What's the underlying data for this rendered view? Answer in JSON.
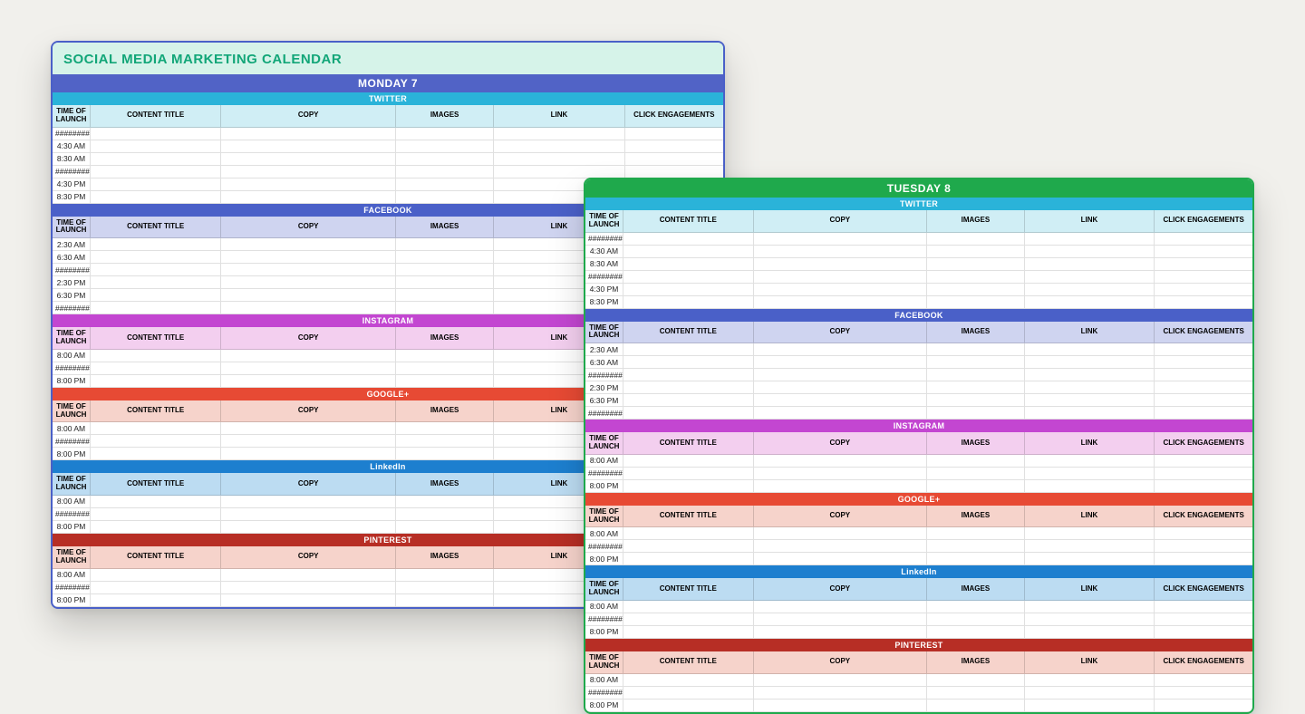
{
  "title": "SOCIAL MEDIA MARKETING CALENDAR",
  "columns": {
    "time": "TIME OF LAUNCH",
    "content": "CONTENT TITLE",
    "copy": "COPY",
    "images": "IMAGES",
    "link": "LINK",
    "clicks": "CLICK ENGAGEMENTS"
  },
  "monday": {
    "day_label": "MONDAY   7",
    "platforms": [
      {
        "name": "TWITTER",
        "bar_class": "pf-twitter",
        "hd_class": "hd-twitter",
        "times": [
          "########",
          "4:30 AM",
          "8:30 AM",
          "########",
          "4:30 PM",
          "8:30 PM"
        ]
      },
      {
        "name": "FACEBOOK",
        "bar_class": "pf-facebook",
        "hd_class": "hd-facebook",
        "times": [
          "2:30 AM",
          "6:30 AM",
          "########",
          "2:30 PM",
          "6:30 PM",
          "########"
        ]
      },
      {
        "name": "INSTAGRAM",
        "bar_class": "pf-instagram",
        "hd_class": "hd-instagram",
        "times": [
          "8:00 AM",
          "########",
          "8:00 PM"
        ]
      },
      {
        "name": "GOOGLE+",
        "bar_class": "pf-google",
        "hd_class": "hd-google",
        "times": [
          "8:00 AM",
          "########",
          "8:00 PM"
        ]
      },
      {
        "name": "LinkedIn",
        "bar_class": "pf-linkedin",
        "hd_class": "hd-linkedin",
        "times": [
          "8:00 AM",
          "########",
          "8:00 PM"
        ]
      },
      {
        "name": "PINTEREST",
        "bar_class": "pf-pinterest",
        "hd_class": "hd-pinterest",
        "times": [
          "8:00 AM",
          "########",
          "8:00 PM"
        ]
      }
    ]
  },
  "tuesday": {
    "day_label": "TUESDAY   8",
    "platforms": [
      {
        "name": "TWITTER",
        "bar_class": "pf-twitter",
        "hd_class": "hd-twitter",
        "times": [
          "########",
          "4:30 AM",
          "8:30 AM",
          "########",
          "4:30 PM",
          "8:30 PM"
        ]
      },
      {
        "name": "FACEBOOK",
        "bar_class": "pf-facebook",
        "hd_class": "hd-facebook",
        "times": [
          "2:30 AM",
          "6:30 AM",
          "########",
          "2:30 PM",
          "6:30 PM",
          "########"
        ]
      },
      {
        "name": "INSTAGRAM",
        "bar_class": "pf-instagram",
        "hd_class": "hd-instagram",
        "times": [
          "8:00 AM",
          "########",
          "8:00 PM"
        ]
      },
      {
        "name": "GOOGLE+",
        "bar_class": "pf-google",
        "hd_class": "hd-google",
        "times": [
          "8:00 AM",
          "########",
          "8:00 PM"
        ]
      },
      {
        "name": "LinkedIn",
        "bar_class": "pf-linkedin",
        "hd_class": "hd-linkedin",
        "times": [
          "8:00 AM",
          "########",
          "8:00 PM"
        ]
      },
      {
        "name": "PINTEREST",
        "bar_class": "pf-pinterest",
        "hd_class": "hd-pinterest",
        "times": [
          "8:00 AM",
          "########",
          "8:00 PM"
        ]
      }
    ]
  }
}
